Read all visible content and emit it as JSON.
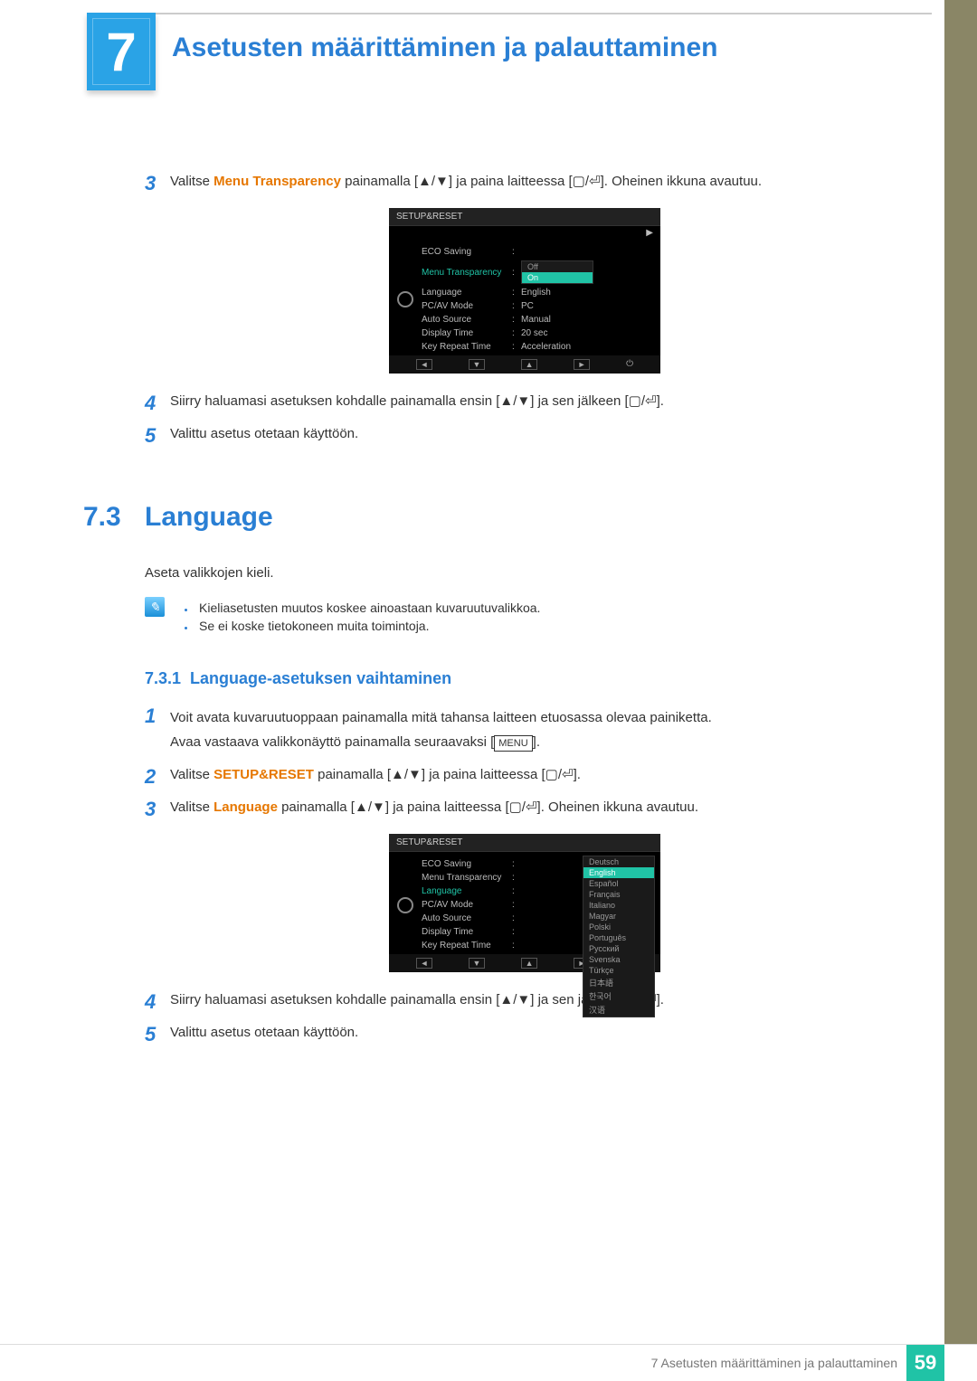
{
  "chapter": {
    "number": "7",
    "title": "Asetusten määrittäminen ja palauttaminen"
  },
  "topsteps": {
    "n3": "3",
    "s3a": "Valitse ",
    "s3_orange": "Menu Transparency",
    "s3b": " painamalla [",
    "s3c": "] ja paina laitteessa [",
    "s3d": "]. Oheinen ikkuna avautuu.",
    "n4": "4",
    "s4a": "Siirry haluamasi asetuksen kohdalle painamalla ensin [",
    "s4b": "] ja sen jälkeen [",
    "s4c": "].",
    "n5": "5",
    "s5": "Valittu asetus otetaan käyttöön."
  },
  "osd1": {
    "title": "SETUP&RESET",
    "rows": [
      {
        "label": "ECO Saving",
        "val": ""
      },
      {
        "label": "Menu Transparency",
        "val": "",
        "active": true
      },
      {
        "label": "Language",
        "val": "English"
      },
      {
        "label": "PC/AV Mode",
        "val": "PC"
      },
      {
        "label": "Auto Source",
        "val": "Manual"
      },
      {
        "label": "Display Time",
        "val": "20 sec"
      },
      {
        "label": "Key Repeat Time",
        "val": "Acceleration"
      }
    ],
    "dropdown": {
      "items": [
        "Off",
        "On"
      ],
      "hl": 1
    }
  },
  "section": {
    "num": "7.3",
    "title": "Language",
    "intro": "Aseta valikkojen kieli."
  },
  "notes": {
    "a": "Kieliasetusten muutos koskee ainoastaan kuvaruutuvalikkoa.",
    "b": "Se ei koske tietokoneen muita toimintoja."
  },
  "subsection": {
    "num": "7.3.1",
    "title": "Language-asetuksen vaihtaminen"
  },
  "steps2": {
    "n1": "1",
    "s1a": "Voit avata kuvaruutuoppaan painamalla mitä tahansa laitteen etuosassa olevaa painiketta.",
    "s1b": "Avaa vastaava valikkonäyttö painamalla seuraavaksi [",
    "s1_box": "MENU",
    "s1c": "].",
    "n2": "2",
    "s2a": "Valitse ",
    "s2_orange": "SETUP&RESET",
    "s2b": " painamalla [",
    "s2c": "] ja paina laitteessa [",
    "s2d": "].",
    "n3": "3",
    "s3a": "Valitse ",
    "s3_orange": "Language",
    "s3b": " painamalla [",
    "s3c": "] ja paina laitteessa [",
    "s3d": "]. Oheinen ikkuna avautuu.",
    "n4": "4",
    "s4a": "Siirry haluamasi asetuksen kohdalle painamalla ensin [",
    "s4b": "] ja sen jälkeen [",
    "s4c": "].",
    "n5": "5",
    "s5": "Valittu asetus otetaan käyttöön."
  },
  "osd2": {
    "title": "SETUP&RESET",
    "rows": [
      {
        "label": "ECO Saving",
        "val": ""
      },
      {
        "label": "Menu Transparency",
        "val": ""
      },
      {
        "label": "Language",
        "val": "",
        "active": true
      },
      {
        "label": "PC/AV Mode",
        "val": ""
      },
      {
        "label": "Auto Source",
        "val": ""
      },
      {
        "label": "Display Time",
        "val": ""
      },
      {
        "label": "Key Repeat Time",
        "val": ""
      }
    ],
    "dropdown": {
      "items": [
        "Deutsch",
        "English",
        "Español",
        "Français",
        "Italiano",
        "Magyar",
        "Polski",
        "Português",
        "Русский",
        "Svenska",
        "Türkçe",
        "日本語",
        "한국어",
        "汉语"
      ],
      "hl": 1
    }
  },
  "sym": {
    "updown": "▲/▼",
    "boxenter": "▢/⏎"
  },
  "footer": {
    "text": "7 Asetusten määrittäminen ja palauttaminen",
    "page": "59"
  }
}
